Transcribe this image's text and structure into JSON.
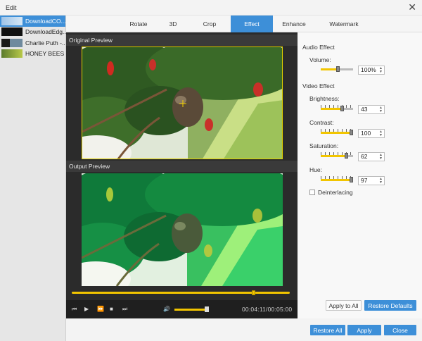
{
  "window": {
    "title": "Edit"
  },
  "files": [
    {
      "label": "DownloadCO...",
      "selected": true
    },
    {
      "label": "DownloadEdg...",
      "selected": false
    },
    {
      "label": "Charlie Puth -...",
      "selected": false
    },
    {
      "label": "HONEY BEES ...",
      "selected": false
    }
  ],
  "tabs": [
    "Rotate",
    "3D",
    "Crop",
    "Effect",
    "Enhance",
    "Watermark"
  ],
  "active_tab": "Effect",
  "preview": {
    "original_label": "Original Preview",
    "output_label": "Output Preview",
    "playback_position": 0.84,
    "volume_level": 0.9,
    "time": "00:04:11/00:05:00"
  },
  "effects": {
    "audio_heading": "Audio Effect",
    "volume": {
      "label": "Volume:",
      "value": "100%",
      "level": 0.55
    },
    "video_heading": "Video Effect",
    "brightness": {
      "label": "Brightness:",
      "value": "43",
      "level": 0.68
    },
    "contrast": {
      "label": "Contrast:",
      "value": "100",
      "level": 0.95
    },
    "saturation": {
      "label": "Saturation:",
      "value": "62",
      "level": 0.8
    },
    "hue": {
      "label": "Hue:",
      "value": "97",
      "level": 0.95
    },
    "deinterlacing": {
      "label": "Deinterlacing",
      "checked": false
    }
  },
  "buttons": {
    "apply_to_all": "Apply to All",
    "restore_defaults": "Restore Defaults",
    "restore_all": "Restore All",
    "apply": "Apply",
    "close": "Close"
  },
  "colors": {
    "accent": "#3d8fd8",
    "slider": "#f2c500"
  }
}
